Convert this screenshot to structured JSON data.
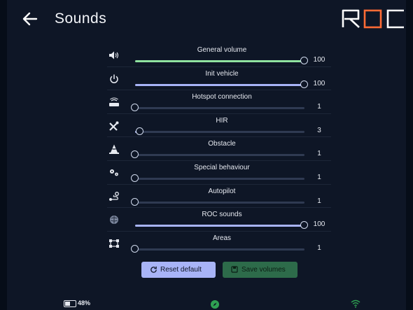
{
  "header": {
    "title": "Sounds",
    "logo_text": "ROC"
  },
  "colors": {
    "background": "#0e1626",
    "accent_green": "#8fe3a0",
    "accent_blue": "#a8b4f7",
    "logo_orange": "#ff6b35"
  },
  "sliders": [
    {
      "label": "General volume",
      "value": "100",
      "level": 1.0,
      "icon": "speaker-icon",
      "fill": "#8fe3a0"
    },
    {
      "label": "Init vehicle",
      "value": "100",
      "level": 1.0,
      "icon": "power-icon",
      "fill": "#a8b4f7"
    },
    {
      "label": "Hotspot connection",
      "value": "1",
      "level": 0.0,
      "icon": "router-icon",
      "fill": "#a8b4f7"
    },
    {
      "label": "HIR",
      "value": "3",
      "level": 0.03,
      "icon": "tools-icon",
      "fill": "#a8b4f7"
    },
    {
      "label": "Obstacle",
      "value": "1",
      "level": 0.0,
      "icon": "traffic-cone-icon",
      "fill": "#a8b4f7"
    },
    {
      "label": "Special behaviour",
      "value": "1",
      "level": 0.0,
      "icon": "gears-icon",
      "fill": "#a8b4f7"
    },
    {
      "label": "Autopilot",
      "value": "1",
      "level": 0.0,
      "icon": "route-icon",
      "fill": "#a8b4f7"
    },
    {
      "label": "ROC sounds",
      "value": "100",
      "level": 1.0,
      "icon": "brain-icon",
      "fill": "#a8b4f7"
    },
    {
      "label": "Areas",
      "value": "1",
      "level": 0.0,
      "icon": "area-select-icon",
      "fill": "#a8b4f7"
    }
  ],
  "buttons": {
    "reset_label": "Reset default",
    "save_label": "Save volumes"
  },
  "footer": {
    "battery_text": "48%",
    "battery_level": 0.48
  }
}
